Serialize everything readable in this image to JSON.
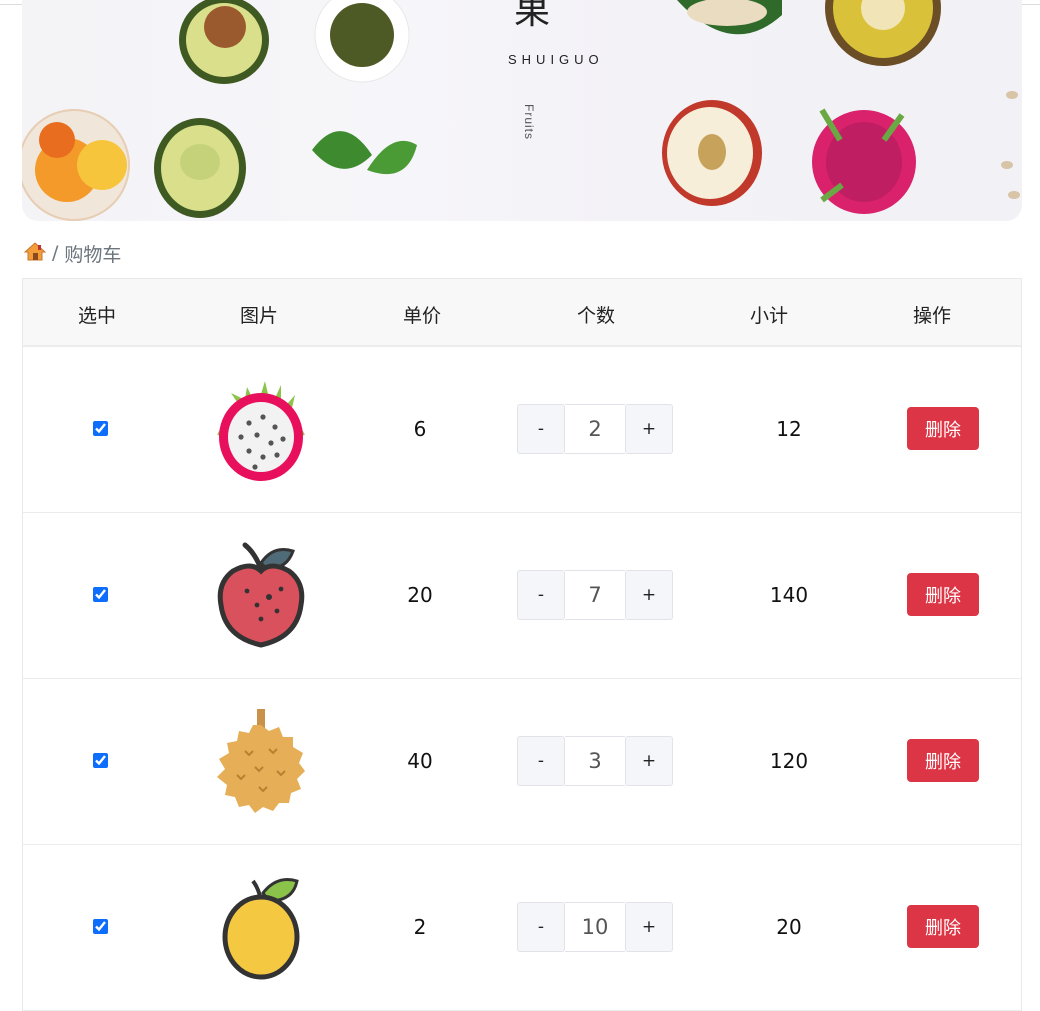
{
  "banner": {
    "title_char": "果",
    "pinyin": "SHUIGUO",
    "english": "Fruits"
  },
  "breadcrumb": {
    "home_icon": "house-icon",
    "separator": "/",
    "current": "购物车"
  },
  "table": {
    "headers": [
      "选中",
      "图片",
      "单价",
      "个数",
      "小计",
      "操作"
    ],
    "rows": [
      {
        "checked": true,
        "fruit_icon": "dragon-fruit-icon",
        "price": "6",
        "qty": "2",
        "subtotal": "12",
        "delete_label": "删除",
        "minus": "-",
        "plus": "+"
      },
      {
        "checked": true,
        "fruit_icon": "lychee-icon",
        "price": "20",
        "qty": "7",
        "subtotal": "140",
        "delete_label": "删除",
        "minus": "-",
        "plus": "+"
      },
      {
        "checked": true,
        "fruit_icon": "durian-icon",
        "price": "40",
        "qty": "3",
        "subtotal": "120",
        "delete_label": "删除",
        "minus": "-",
        "plus": "+"
      },
      {
        "checked": true,
        "fruit_icon": "lemon-icon",
        "price": "2",
        "qty": "10",
        "subtotal": "20",
        "delete_label": "删除",
        "minus": "-",
        "plus": "+"
      }
    ]
  },
  "colors": {
    "danger": "#dc3545",
    "checkbox": "#0d6efd",
    "header_bg": "#f8f8f8"
  }
}
